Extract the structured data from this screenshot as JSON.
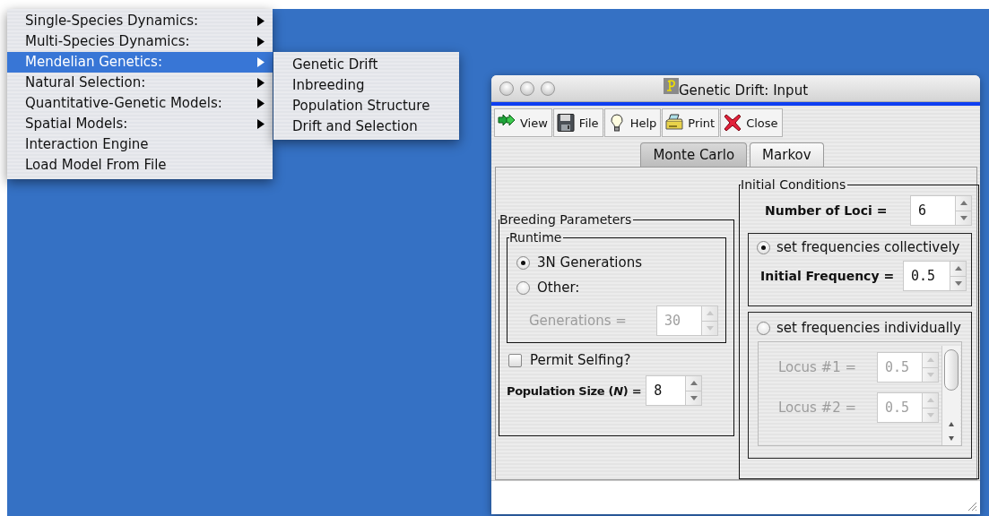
{
  "menu": {
    "items": [
      {
        "label": "Single-Species Dynamics:",
        "submenu": true,
        "selected": false
      },
      {
        "label": "Multi-Species Dynamics:",
        "submenu": true,
        "selected": false
      },
      {
        "label": "Mendelian Genetics:",
        "submenu": true,
        "selected": true
      },
      {
        "label": "Natural Selection:",
        "submenu": true,
        "selected": false
      },
      {
        "label": "Quantitative-Genetic Models:",
        "submenu": true,
        "selected": false
      },
      {
        "label": "Spatial Models:",
        "submenu": true,
        "selected": false
      },
      {
        "label": "Interaction Engine",
        "submenu": false,
        "selected": false
      },
      {
        "label": "Load Model From File",
        "submenu": false,
        "selected": false
      }
    ]
  },
  "submenu": {
    "items": [
      {
        "label": "Genetic Drift",
        "selected": false
      },
      {
        "label": "Inbreeding",
        "selected": false
      },
      {
        "label": "Population Structure",
        "selected": false
      },
      {
        "label": "Drift and Selection",
        "selected": false
      }
    ]
  },
  "window": {
    "title": "Genetic Drift: Input",
    "toolbar": [
      {
        "label": "View",
        "kind": "arrows"
      },
      {
        "label": "File",
        "kind": "disk"
      },
      {
        "label": "Help",
        "kind": "bulb"
      },
      {
        "label": "Print",
        "kind": "printer"
      },
      {
        "label": "Close",
        "kind": "cross"
      }
    ],
    "tabs": [
      {
        "label": "Monte Carlo",
        "selected": true
      },
      {
        "label": "Markov",
        "selected": false
      }
    ],
    "breeding_parameters": {
      "title": "Breeding Parameters",
      "runtime": {
        "title": "Runtime",
        "options": [
          {
            "label": "3N Generations",
            "selected": true
          },
          {
            "label": "Other:",
            "selected": false
          }
        ],
        "generations": {
          "label": "Generations =",
          "value": "30",
          "disabled": true
        }
      },
      "permit_selfing": {
        "label": "Permit Selfing?",
        "checked": false
      },
      "population_size": {
        "label": "Population Size (*N*) =",
        "value": "8"
      }
    },
    "initial_conditions": {
      "title": "Initial Conditions",
      "number_of_loci": {
        "label": "Number of Loci =",
        "value": "6"
      },
      "collective": {
        "label": "set frequencies collectively",
        "selected": true,
        "initial_frequency": {
          "label": "Initial Frequency =",
          "value": "0.5"
        }
      },
      "individual": {
        "label": "set frequencies individually",
        "selected": false,
        "disabled": true,
        "loci": [
          {
            "label": "Locus #1 =",
            "value": "0.5"
          },
          {
            "label": "Locus #2 =",
            "value": "0.5"
          }
        ]
      }
    }
  }
}
